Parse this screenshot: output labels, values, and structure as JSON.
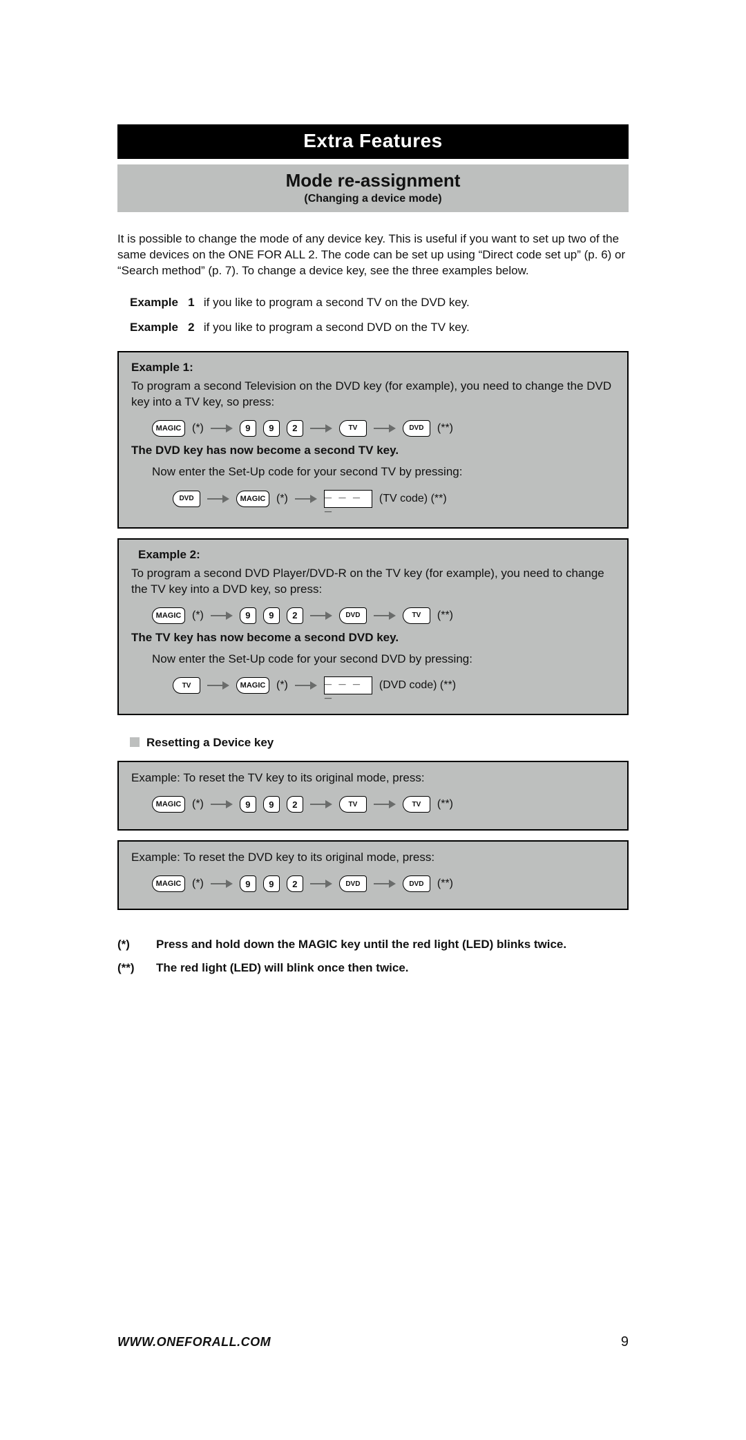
{
  "header": {
    "black_title": "Extra Features",
    "grey_title": "Mode re-assignment",
    "grey_subtitle": "(Changing a device mode)"
  },
  "intro": "It is possible to change the mode of any device key. This is useful if you want to set up two of the same devices on the ONE FOR ALL 2. The code can be set up using “Direct code set up” (p. 6) or “Search method” (p. 7). To change a device key, see the three examples below.",
  "ex_label": "Example",
  "ex1_num": "1",
  "ex1_line": "if you like to program a second TV on the DVD key.",
  "ex2_num": "2",
  "ex2_line": "if you like to program a second DVD on the TV key.",
  "keys": {
    "magic": "MAGIC",
    "tv": "TV",
    "dvd": "DVD",
    "nine": "9",
    "two": "2",
    "star": "(*)",
    "dstar": "(**)",
    "codebox": "_ _ _ _"
  },
  "box1": {
    "title": "Example 1:",
    "desc": "To program a second Television on the DVD key (for example), you need to change the DVD key into a TV key, so press:",
    "result": "The DVD key has now become a second TV key.",
    "now": "Now enter the Set-Up code for your second TV by pressing:",
    "code_label": "(TV code) (**)"
  },
  "box2": {
    "title": "Example 2:",
    "desc": "To program a second DVD Player/DVD-R on the TV key (for example), you need to change the TV key into a DVD key, so press:",
    "result": "The TV key has now become a second DVD key.",
    "now": "Now enter the Set-Up code for your second DVD by pressing:",
    "code_label": "(DVD code) (**)"
  },
  "reset": {
    "heading": "Resetting a Device key",
    "ex_tv": "Example: To reset the TV key to its original mode, press:",
    "ex_dvd": "Example: To reset the DVD key to its original mode, press:"
  },
  "notes": {
    "n1_mark": "(*)",
    "n1_text": "Press and hold down the MAGIC key until the red light (LED) blinks twice.",
    "n2_mark": "(**)",
    "n2_text": "The red light (LED) will blink once then twice."
  },
  "footer": {
    "url": "WWW.ONEFORALL.COM",
    "page": "9"
  }
}
